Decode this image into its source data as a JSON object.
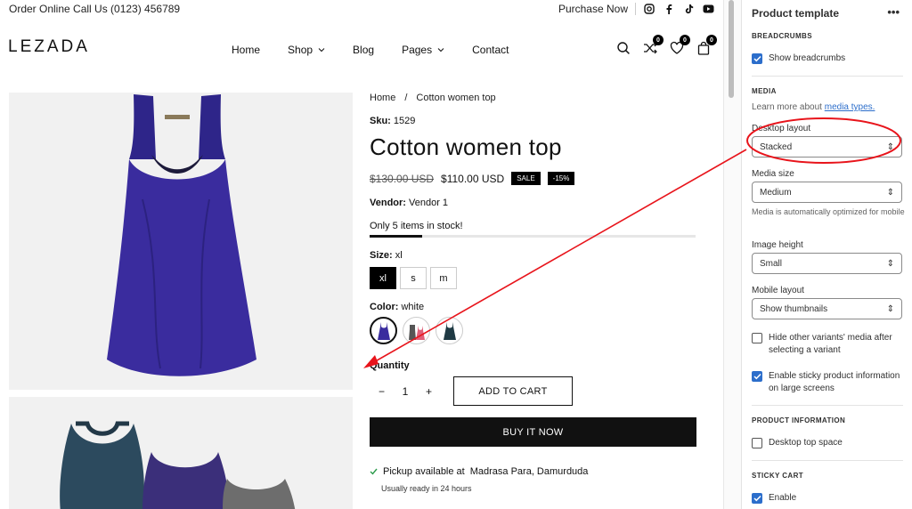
{
  "topbar": {
    "left_text": "Order Online Call Us (0123) 456789",
    "purchase": "Purchase Now",
    "social": [
      "instagram-icon",
      "facebook-icon",
      "tiktok-icon",
      "youtube-icon"
    ]
  },
  "header": {
    "logo": "LEZADA",
    "nav": [
      {
        "label": "Home",
        "dropdown": false
      },
      {
        "label": "Shop",
        "dropdown": true
      },
      {
        "label": "Blog",
        "dropdown": false
      },
      {
        "label": "Pages",
        "dropdown": true
      },
      {
        "label": "Contact",
        "dropdown": false
      }
    ],
    "compare_count": "0",
    "wishlist_count": "0",
    "cart_count": "0"
  },
  "product": {
    "breadcrumb_home": "Home",
    "breadcrumb_sep": "/",
    "breadcrumb_current": "Cotton women top",
    "sku_label": "Sku:",
    "sku": "1529",
    "title": "Cotton women top",
    "old_price": "$130.00 USD",
    "price": "$110.00 USD",
    "sale_badge": "SALE",
    "discount_badge": "-15%",
    "vendor_label": "Vendor:",
    "vendor": "Vendor 1",
    "stock_text": "Only 5 items in stock!",
    "stock_level": 0.16,
    "size_label": "Size:",
    "size_value": "xl",
    "sizes": [
      "xl",
      "s",
      "m"
    ],
    "color_label": "Color:",
    "color_value": "white",
    "quantity_label": "Quantity",
    "qty_minus": "−",
    "qty_value": "1",
    "qty_plus": "+",
    "add_to_cart": "ADD TO CART",
    "buy_now": "BUY IT NOW",
    "pickup_prefix": "Pickup available at",
    "pickup_location": "Madrasa Para, Damurduda",
    "pickup_ready": "Usually ready in 24 hours"
  },
  "panel": {
    "title": "Product template",
    "more": "•••",
    "breadcrumbs_heading": "BREADCRUMBS",
    "show_breadcrumbs": "Show breadcrumbs",
    "media_heading": "MEDIA",
    "learn_prefix": "Learn more about",
    "learn_link": "media types.",
    "desktop_layout_label": "Desktop layout",
    "desktop_layout_value": "Stacked",
    "media_size_label": "Media size",
    "media_size_value": "Medium",
    "media_hint": "Media is automatically optimized for mobile",
    "image_height_label": "Image height",
    "image_height_value": "Small",
    "mobile_layout_label": "Mobile layout",
    "mobile_layout_value": "Show thumbnails",
    "hide_variants": "Hide other variants' media after selecting a variant",
    "sticky_info": "Enable sticky product information on large screens",
    "product_info_heading": "PRODUCT INFORMATION",
    "desktop_top_space": "Desktop top space",
    "sticky_cart_heading": "STICKY CART",
    "enable": "Enable"
  },
  "colors": {
    "annotation": "#e8141b",
    "accent": "#2c6ecb",
    "product": "#3a2c9e"
  }
}
